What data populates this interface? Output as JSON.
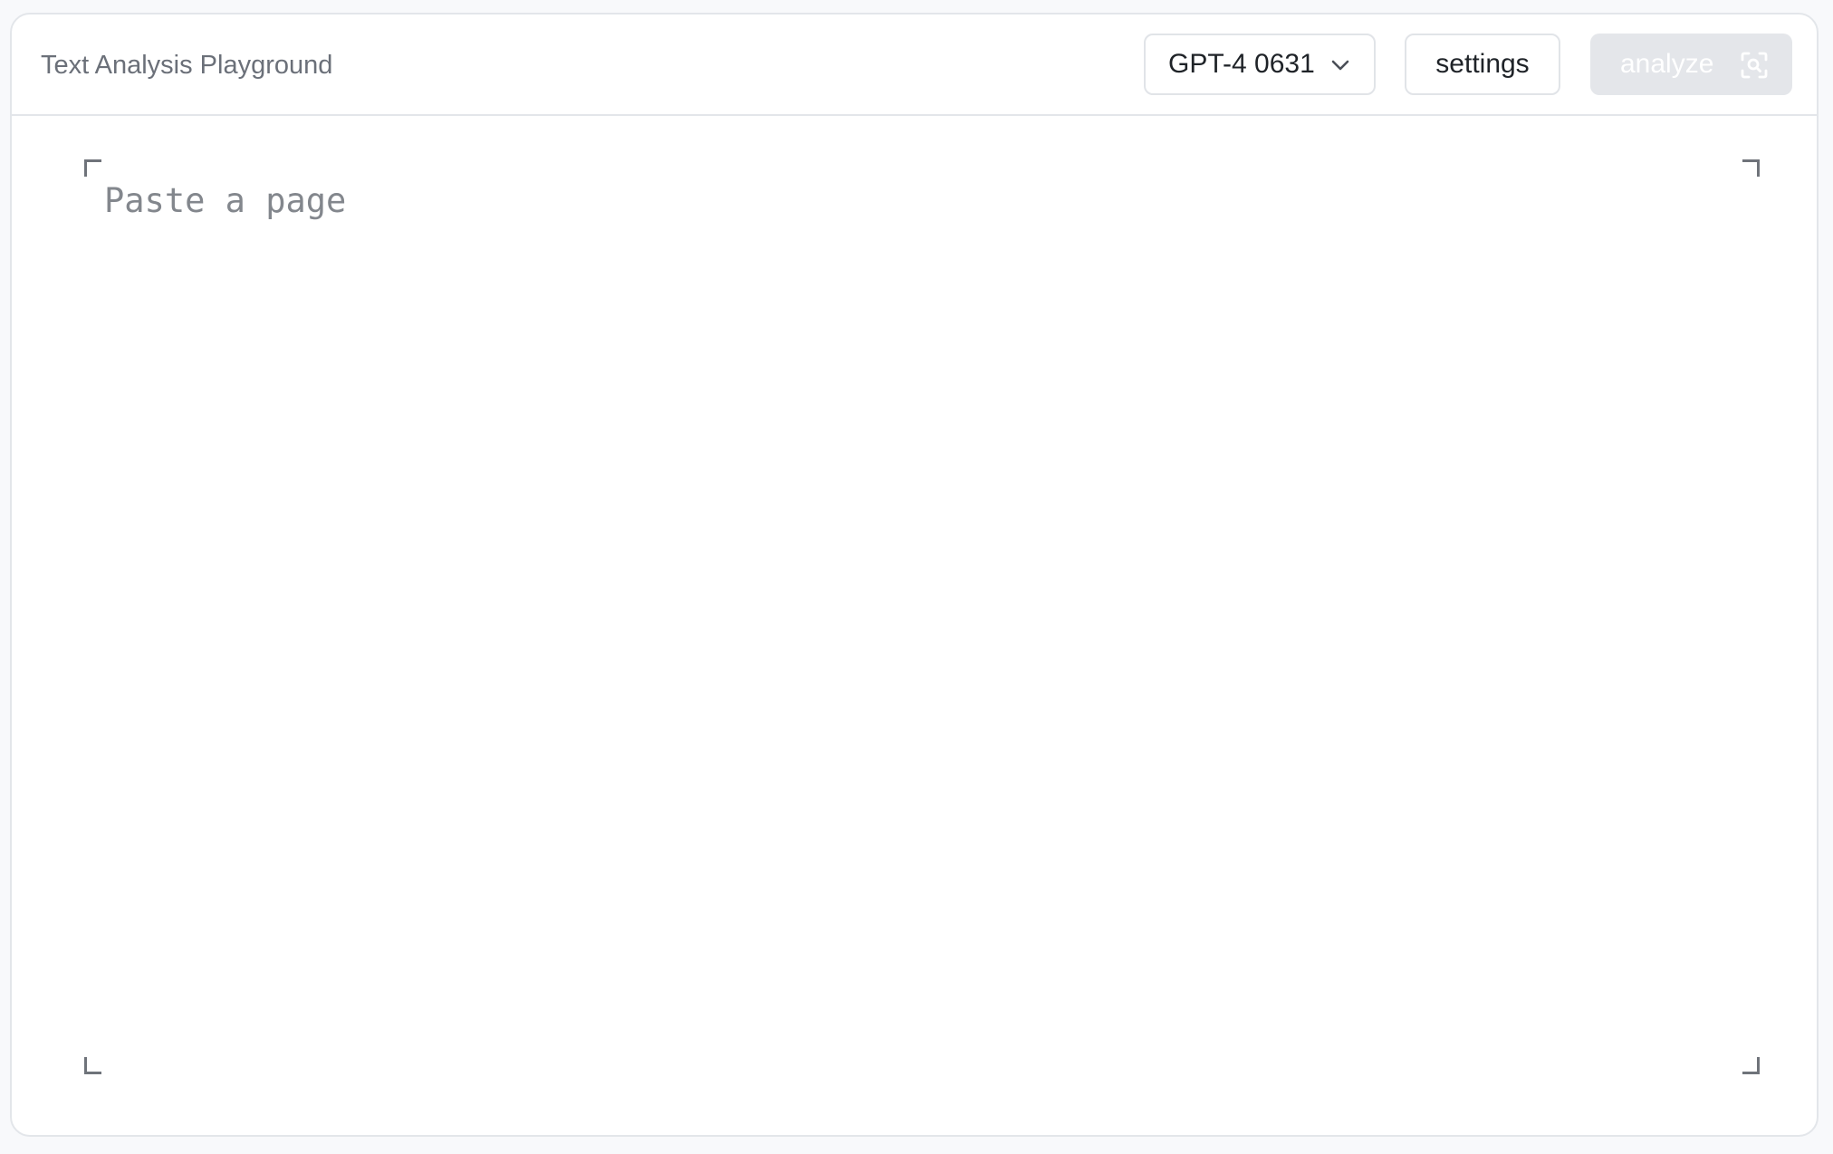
{
  "header": {
    "title": "Text Analysis Playground"
  },
  "toolbar": {
    "model_select": {
      "selected": "GPT-4 0631",
      "icon": "chevron-down-icon"
    },
    "settings_label": "settings",
    "analyze_label": "analyze",
    "analyze_icon": "scan-search-icon",
    "analyze_disabled": true
  },
  "editor": {
    "value": "",
    "placeholder": "Paste a page"
  },
  "colors": {
    "page_background": "#f8f9fb",
    "card_border": "#e3e6ea",
    "muted_text": "#6b7079",
    "disabled_button": "#e4e6ea"
  }
}
